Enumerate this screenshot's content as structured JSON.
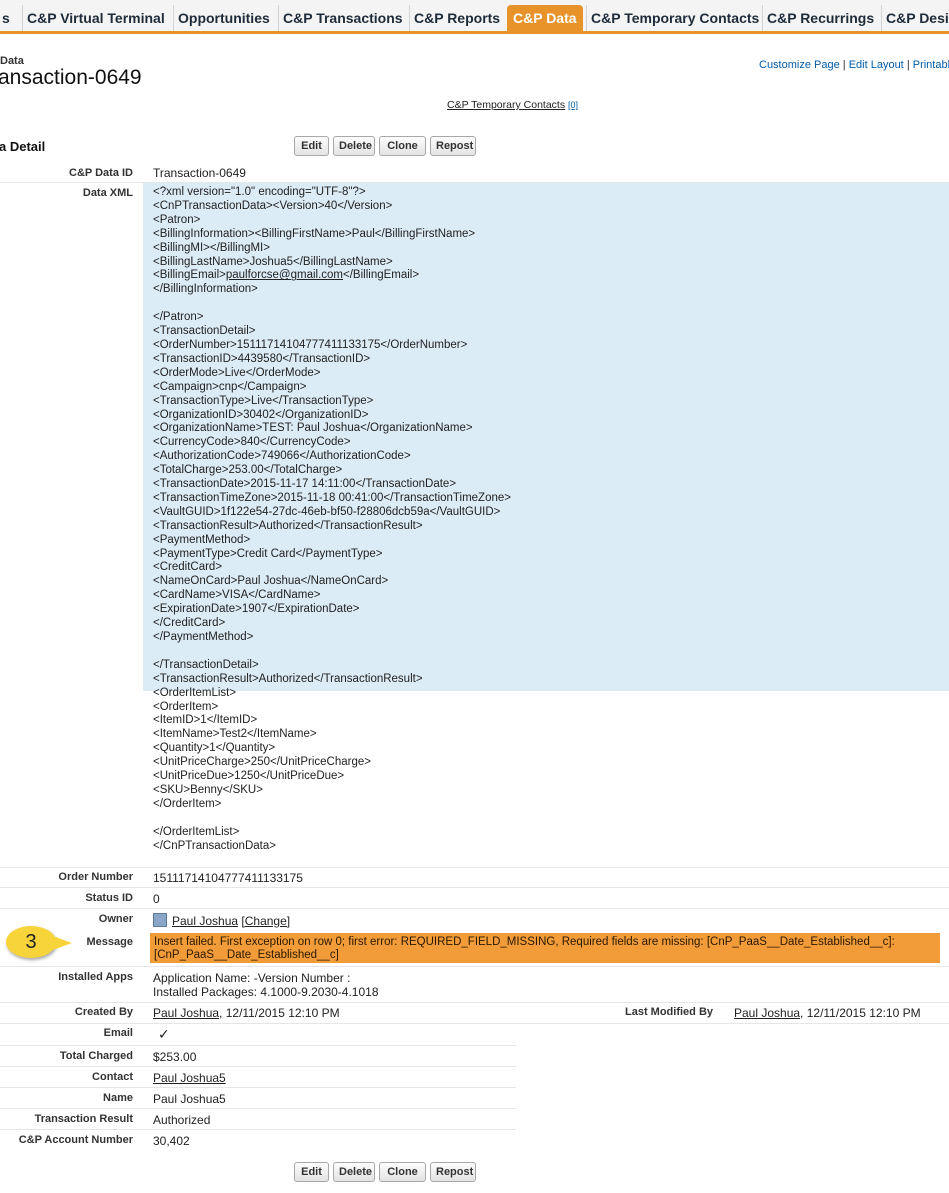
{
  "tabs": [
    "s",
    "C&P Virtual Terminal",
    "Opportunities",
    "C&P Transactions",
    "C&P Reports",
    "C&P Data",
    "C&P Temporary Contacts",
    "C&P Recurrings",
    "C&P Desig"
  ],
  "active_tab": "C&P Data",
  "header": {
    "object_type": "Data",
    "record_name": "ansaction-0649",
    "links": {
      "customize": "Customize Page",
      "sep1": "|",
      "edit_layout": "Edit Layout",
      "sep2": "|",
      "printable": "Printable"
    },
    "related_link": "C&P Temporary Contacts",
    "related_count": "[0]"
  },
  "detail": {
    "title": "a Detail",
    "buttons": {
      "edit": "Edit",
      "delete": "Delete",
      "clone": "Clone",
      "repost": "Repost"
    }
  },
  "fields": {
    "data_id": {
      "label": "C&P Data ID",
      "value": "Transaction-0649"
    },
    "data_xml": {
      "label": "Data XML",
      "lines_before_email": "<?xml version=\"1.0\" encoding=\"UTF-8\"?>\n<CnPTransactionData><Version>40</Version>\n<Patron>\n<BillingInformation><BillingFirstName>Paul</BillingFirstName>\n<BillingMI></BillingMI>\n<BillingLastName>Joshua5</BillingLastName>\n<BillingEmail>",
      "email": "paulforcse@gmail.com",
      "email_close": "</BillingEmail>",
      "lines_after_email": "</BillingInformation>\n\n</Patron>\n<TransactionDetail>\n<OrderNumber>151117141047774111331​75</OrderNumber>\n<TransactionID>4439580</TransactionID>\n<OrderMode>Live</OrderMode>\n<Campaign>cnp</Campaign>\n<TransactionType>Live</TransactionType>\n<OrganizationID>30402</OrganizationID>\n<OrganizationName>TEST: Paul Joshua</OrganizationName>\n<CurrencyCode>840</CurrencyCode>\n<AuthorizationCode>749066</AuthorizationCode>\n<TotalCharge>253.00</TotalCharge>\n<TransactionDate>2015-11-17 14:11:00</TransactionDate>\n<TransactionTimeZone>2015-11-18 00:41:00</TransactionTimeZone>\n<VaultGUID>1f122e54-27dc-46eb-bf50-f28806dcb59a</VaultGUID>\n<TransactionResult>Authorized</TransactionResult>\n<PaymentMethod>\n<PaymentType>Credit Card</PaymentType>\n<CreditCard>\n<NameOnCard>Paul Joshua</NameOnCard>\n<CardName>VISA</CardName>\n<ExpirationDate>1907</ExpirationDate>\n</CreditCard>\n</PaymentMethod>\n\n</TransactionDetail>\n<TransactionResult>Authorized</TransactionResult>\n<OrderItemList>\n<OrderItem>\n<ItemID>1</ItemID>\n<ItemName>Test2</ItemName>\n<Quantity>1</Quantity>\n<UnitPriceCharge>250</UnitPriceCharge>\n<UnitPriceDue>1250</UnitPriceDue>\n<SKU>Benny</SKU>\n</OrderItem>\n\n</OrderItemList>\n</CnPTransactionData>"
    },
    "order_number": {
      "label": "Order Number",
      "value": "15111714104777411133175"
    },
    "status_id": {
      "label": "Status ID",
      "value": "0"
    },
    "owner": {
      "label": "Owner",
      "value": "Paul Joshua",
      "change": "[Change]"
    },
    "message": {
      "label": "Message",
      "line1": "Insert failed. First exception on row 0; first error: REQUIRED_FIELD_MISSING, Required fields are missing: [CnP_PaaS__Date_Established__c]:",
      "line2": "[CnP_PaaS__Date_Established__c]"
    },
    "installed_apps": {
      "label": "Installed Apps",
      "line1": "Application Name: -Version Number :",
      "line2": "Installed Packages: 4.1000-9.2030-4.1018"
    },
    "created_by": {
      "label": "Created By",
      "user": "Paul Joshua",
      "date": ", 12/11/2015 12:10 PM"
    },
    "modified_by": {
      "label": "Last Modified By",
      "user": "Paul Joshua",
      "date": ", 12/11/2015 12:10 PM"
    },
    "email": {
      "label": "Email",
      "value": "✓"
    },
    "total_charged": {
      "label": "Total Charged",
      "value": "$253.00"
    },
    "contact": {
      "label": "Contact",
      "value": "Paul Joshua5"
    },
    "name": {
      "label": "Name",
      "value": "Paul Joshua5"
    },
    "transaction_result": {
      "label": "Transaction Result",
      "value": "Authorized"
    },
    "account_number": {
      "label": "C&P Account Number",
      "value": "30,402"
    }
  },
  "callout": {
    "number": "3"
  },
  "colors": {
    "accent": "#e8932a",
    "xml_highlight": "#dcecf7",
    "message_bg": "#f29b39",
    "callout": "#f7d53a"
  }
}
